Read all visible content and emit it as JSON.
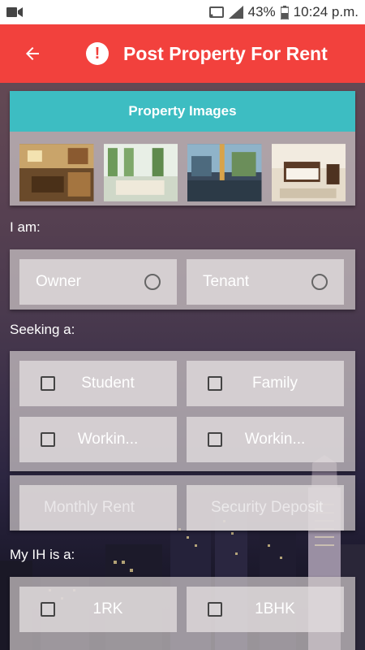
{
  "status_bar": {
    "battery_percent": "43%",
    "time": "10:24 p.m."
  },
  "app_bar": {
    "title": "Post Property For Rent",
    "alert_glyph": "!"
  },
  "images_card": {
    "header": "Property Images",
    "thumbnails": [
      "kitchen-photo",
      "living-room-photo",
      "lobby-photo",
      "bedroom-photo"
    ]
  },
  "i_am": {
    "label": "I am:",
    "options": [
      "Owner",
      "Tenant"
    ]
  },
  "seeking": {
    "label": "Seeking a:",
    "options": [
      "Student",
      "Family",
      "Workin...",
      "Workin..."
    ]
  },
  "rent": {
    "monthly_placeholder": "Monthly Rent",
    "deposit_placeholder": "Security Deposit"
  },
  "my_ih": {
    "label": "My IH is a:",
    "options": [
      "1RK",
      "1BHK"
    ]
  },
  "colors": {
    "app_bar": "#f2413d",
    "card_header": "#3dbdc2"
  }
}
